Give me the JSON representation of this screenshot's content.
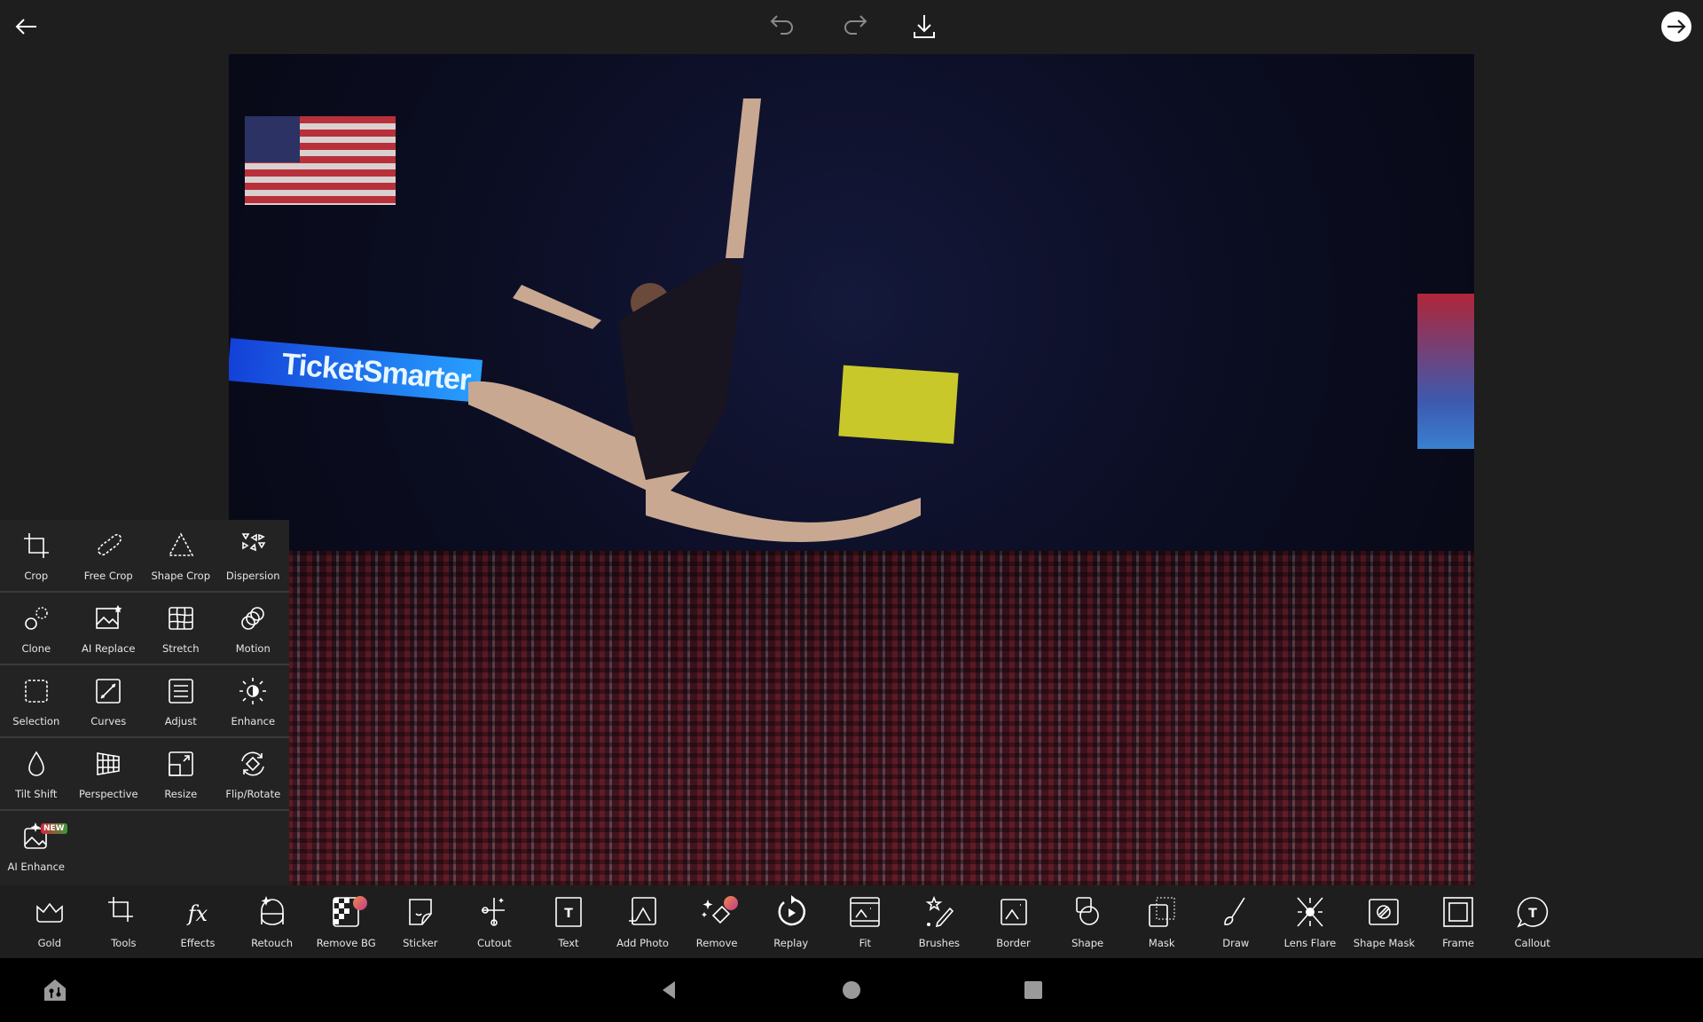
{
  "topbar": {
    "back_icon": "arrow-left-icon",
    "undo_icon": "undo-icon",
    "redo_icon": "redo-icon",
    "download_icon": "download-icon",
    "next_icon": "arrow-right-circle-icon"
  },
  "photo": {
    "sign_text": "TicketSmarter"
  },
  "tools_panel": {
    "rows": [
      [
        {
          "label": "Crop",
          "icon": "crop"
        },
        {
          "label": "Free Crop",
          "icon": "freecrop"
        },
        {
          "label": "Shape Crop",
          "icon": "shapecrop"
        },
        {
          "label": "Dispersion",
          "icon": "dispersion"
        }
      ],
      [
        {
          "label": "Clone",
          "icon": "clone"
        },
        {
          "label": "AI Replace",
          "icon": "aireplace"
        },
        {
          "label": "Stretch",
          "icon": "stretch"
        },
        {
          "label": "Motion",
          "icon": "motion"
        }
      ],
      [
        {
          "label": "Selection",
          "icon": "selection"
        },
        {
          "label": "Curves",
          "icon": "curves"
        },
        {
          "label": "Adjust",
          "icon": "adjust"
        },
        {
          "label": "Enhance",
          "icon": "enhance"
        }
      ],
      [
        {
          "label": "Tilt Shift",
          "icon": "tiltshift"
        },
        {
          "label": "Perspective",
          "icon": "perspective"
        },
        {
          "label": "Resize",
          "icon": "resize"
        },
        {
          "label": "Flip/Rotate",
          "icon": "fliprotate"
        }
      ],
      [
        {
          "label": "AI Enhance",
          "icon": "aienhance",
          "badge": "NEW"
        }
      ]
    ]
  },
  "toolbar": {
    "items": [
      {
        "label": "Gold",
        "icon": "crown"
      },
      {
        "label": "Tools",
        "icon": "crop"
      },
      {
        "label": "Effects",
        "icon": "fx"
      },
      {
        "label": "Retouch",
        "icon": "retouch"
      },
      {
        "label": "Remove BG",
        "icon": "removebg",
        "pro": true
      },
      {
        "label": "Sticker",
        "icon": "sticker"
      },
      {
        "label": "Cutout",
        "icon": "cutout"
      },
      {
        "label": "Text",
        "icon": "text"
      },
      {
        "label": "Add Photo",
        "icon": "addphoto"
      },
      {
        "label": "Remove",
        "icon": "remove",
        "pro": true
      },
      {
        "label": "Replay",
        "icon": "replay"
      },
      {
        "label": "Fit",
        "icon": "fit"
      },
      {
        "label": "Brushes",
        "icon": "brushes"
      },
      {
        "label": "Border",
        "icon": "border"
      },
      {
        "label": "Shape",
        "icon": "shape"
      },
      {
        "label": "Mask",
        "icon": "mask"
      },
      {
        "label": "Draw",
        "icon": "draw"
      },
      {
        "label": "Lens Flare",
        "icon": "lensflare"
      },
      {
        "label": "Shape Mask",
        "icon": "shapemask"
      },
      {
        "label": "Frame",
        "icon": "frame"
      },
      {
        "label": "Callout",
        "icon": "callout"
      }
    ]
  },
  "navbar": {
    "home_icon": "app-home-icon",
    "back_icon": "triangle-back-icon",
    "home_circle_icon": "circle-home-icon",
    "recents_icon": "square-recents-icon"
  },
  "colors": {
    "toolbar_bg": "#1e1e1e",
    "panel_bg": "#232323",
    "pro_badge": "#c03a8a",
    "new_badge": "#d8263a"
  }
}
